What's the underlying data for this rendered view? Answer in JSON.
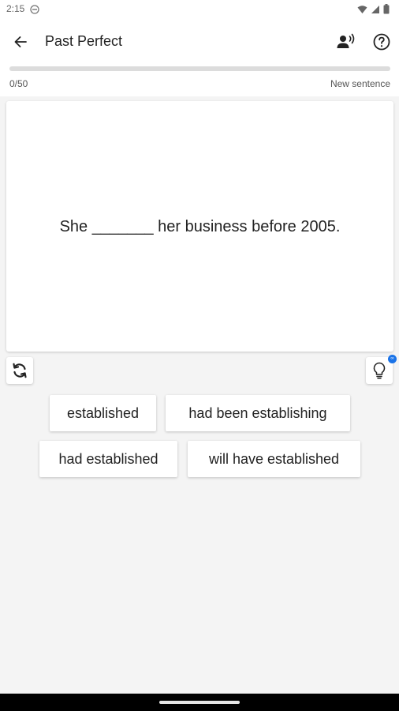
{
  "status_bar": {
    "time": "2:15",
    "dnd_icon": "do-not-disturb-icon",
    "wifi_icon": "wifi-icon",
    "signal_icon": "signal-icon",
    "battery_icon": "battery-icon"
  },
  "app_bar": {
    "back_icon": "arrow-left-icon",
    "title": "Past Perfect",
    "listen_icon": "voice-icon",
    "help_icon": "help-circle-icon"
  },
  "progress": {
    "count": "0/50",
    "fraction": 0.0,
    "new_sentence_label": "New sentence"
  },
  "sentence": {
    "text": "She _______ her business before 2005."
  },
  "controls": {
    "refresh_icon": "refresh-icon",
    "hint_icon": "lightbulb-icon",
    "hint_badge_text": "∞"
  },
  "options": [
    {
      "label": "established"
    },
    {
      "label": "had been establishing"
    },
    {
      "label": "had established"
    },
    {
      "label": "will have established"
    }
  ],
  "colors": {
    "accent": "#1a73e8",
    "background": "#f4f4f4",
    "card": "#ffffff"
  }
}
